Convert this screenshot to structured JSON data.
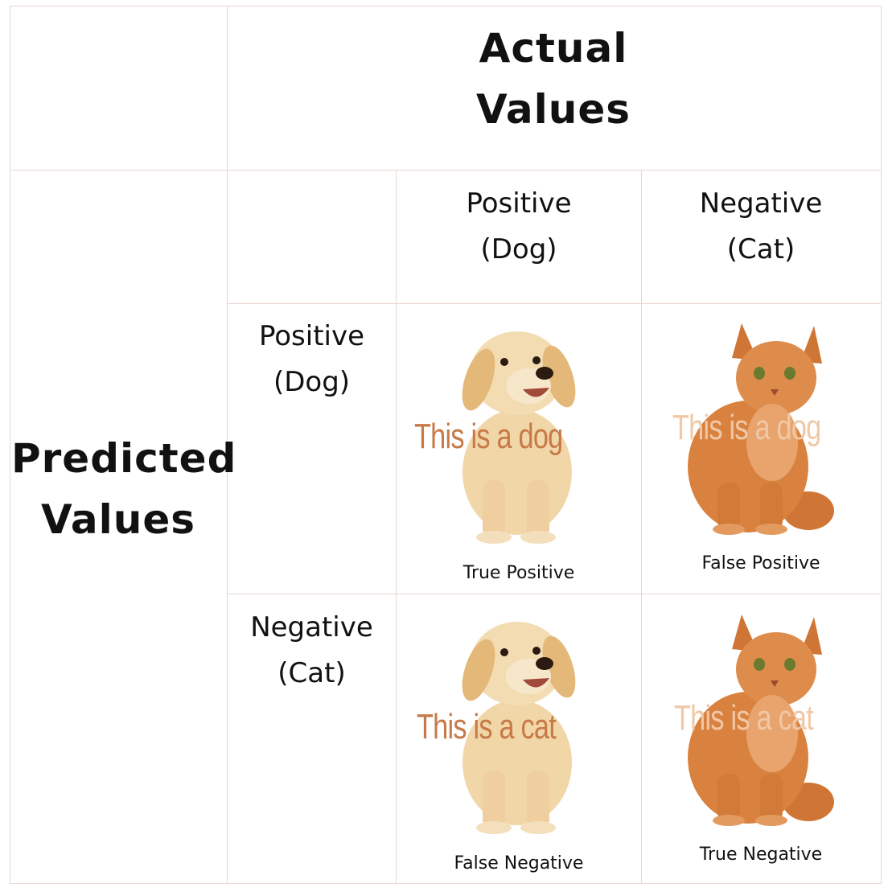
{
  "actual_header": {
    "line1": "Actual",
    "line2": "Values"
  },
  "predicted_header": {
    "line1": "Predicted",
    "line2": "Values"
  },
  "columns": [
    {
      "line1": "Positive",
      "line2": "(Dog)"
    },
    {
      "line1": "Negative",
      "line2": "(Cat)"
    }
  ],
  "rows": [
    {
      "line1": "Positive",
      "line2": "(Dog)"
    },
    {
      "line1": "Negative",
      "line2": "(Cat)"
    }
  ],
  "cells": [
    {
      "image": "dog-photo",
      "caption": "This is a dog",
      "outcome": "True Positive"
    },
    {
      "image": "cat-photo",
      "caption": "This is a dog",
      "outcome": "False Positive"
    },
    {
      "image": "dog-photo",
      "caption": "This is a cat",
      "outcome": "False Negative"
    },
    {
      "image": "cat-photo",
      "caption": "This is a cat",
      "outcome": "True Negative"
    }
  ],
  "colors": {
    "grid": "#e6d7cf",
    "dog_caption": "#c77a48",
    "cat_caption": "#f0c8a6",
    "dog_fur": "#f1d6a8",
    "cat_fur": "#d9823f"
  }
}
